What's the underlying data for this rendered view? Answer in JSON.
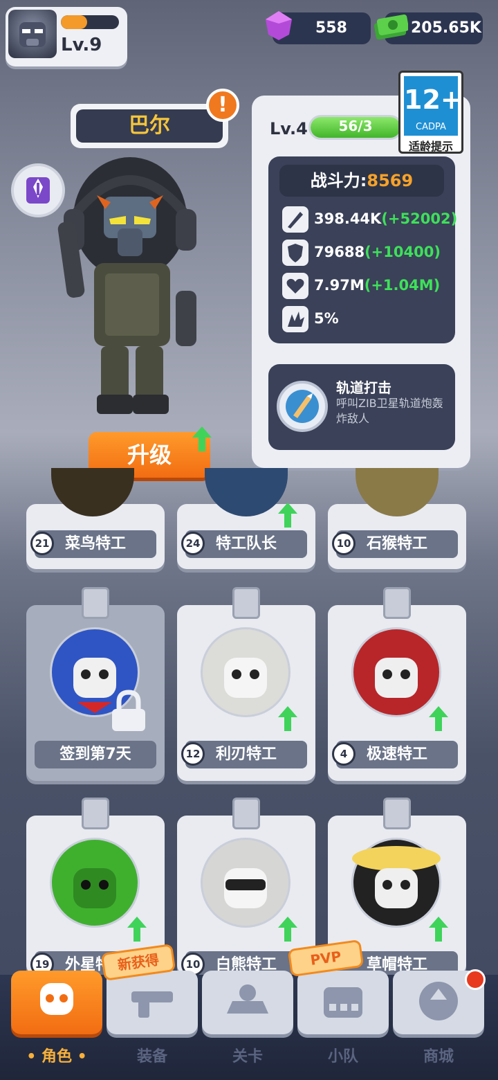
{
  "player": {
    "level": "Lv.9",
    "xp_progress": 0.45
  },
  "resources": {
    "gems": "558",
    "cash": "205.65K"
  },
  "hero": {
    "name": "巴尔",
    "upgrade_label": "升级"
  },
  "stats": {
    "level": "Lv.4",
    "progress_text": "56/3",
    "power_label": "战斗力:",
    "power_value": "8569",
    "attack": "398.44K",
    "attack_bonus": "(+52002)",
    "defense": "79688",
    "defense_bonus": "(+10400)",
    "hp": "7.97M",
    "hp_bonus": "(+1.04M)",
    "crit": "5%"
  },
  "age_rating": {
    "number": "12+",
    "org": "CADPA",
    "label": "适龄提示"
  },
  "skill": {
    "name": "轨道打击",
    "desc": "呼叫ZIB卫星轨道炮轰炸敌人"
  },
  "cards_row1": [
    {
      "level": "21",
      "name": "菜鸟特工"
    },
    {
      "level": "24",
      "name": "特工队长"
    },
    {
      "level": "10",
      "name": "石猴特工"
    }
  ],
  "cards_row2": [
    {
      "level": "",
      "name": "签到第7天"
    },
    {
      "level": "12",
      "name": "利刃特工"
    },
    {
      "level": "4",
      "name": "极速特工"
    }
  ],
  "cards_row3": [
    {
      "level": "19",
      "name": "外星特工"
    },
    {
      "level": "10",
      "name": "白熊特工"
    },
    {
      "level": "",
      "name": "草帽特工"
    }
  ],
  "nav": {
    "items": [
      "角色",
      "装备",
      "关卡",
      "小队",
      "商城"
    ],
    "tag_new": "新获得",
    "tag_pvp": "PVP"
  },
  "colors": {
    "accent": "#f26d12",
    "gold": "#f5c53b",
    "green": "#3ee05a"
  }
}
